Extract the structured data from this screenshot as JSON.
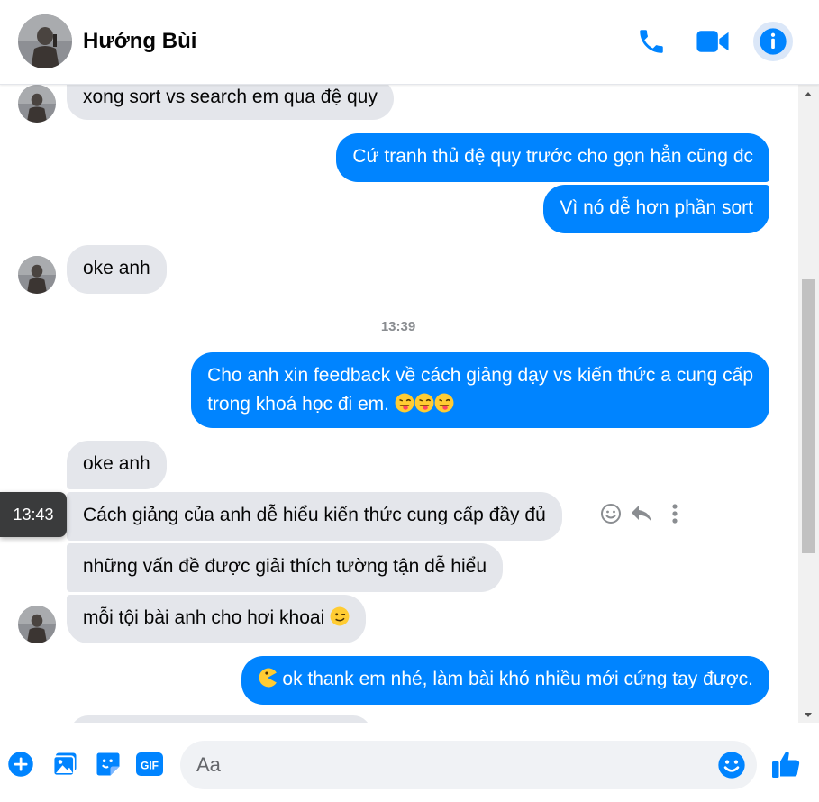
{
  "header": {
    "name": "Hướng Bùi",
    "actions": [
      "phone-call",
      "video-call",
      "conversation-info"
    ]
  },
  "chat": {
    "timestamp": "13:39",
    "hover_time": "13:43",
    "messages": [
      {
        "from": "them",
        "text": "xong sort vs search em qua đệ quy"
      },
      {
        "from": "me",
        "text": "Cứ tranh thủ đệ quy trước cho gọn hẳn cũng đc"
      },
      {
        "from": "me",
        "text": "Vì nó dễ hơn phần sort"
      },
      {
        "from": "them",
        "text": "oke anh"
      },
      {
        "from": "me",
        "text_line1": "Cho anh xin feedback về cách giảng dạy vs kiến thức a cung cấp",
        "text_line2": "trong khoá học đi em.",
        "emoji": [
          "winking-face-with-tongue",
          "winking-face-with-tongue",
          "winking-face-with-tongue"
        ]
      },
      {
        "from": "them",
        "text": "oke anh"
      },
      {
        "from": "them",
        "text": "Cách giảng của anh dễ hiểu kiến thức cung cấp đầy đủ"
      },
      {
        "from": "them",
        "text": "những vấn đề được giải thích tường tận dễ hiểu"
      },
      {
        "from": "them",
        "text": "mỗi tội bài anh cho hơi khoai",
        "emoji": [
          "winking-face"
        ]
      },
      {
        "from": "me",
        "text": "ok thank em nhé, làm bài khó nhiều mới cứng tay được.",
        "emoji": [
          "pacman-face"
        ]
      }
    ]
  },
  "composer": {
    "placeholder": "Aa",
    "value": "",
    "tools": [
      "add",
      "photo",
      "sticker",
      "gif"
    ],
    "gif_label": "GIF"
  },
  "colors": {
    "accent": "#0084ff",
    "incoming_bubble": "#e4e6eb",
    "outgoing_bubble": "#0084ff"
  }
}
